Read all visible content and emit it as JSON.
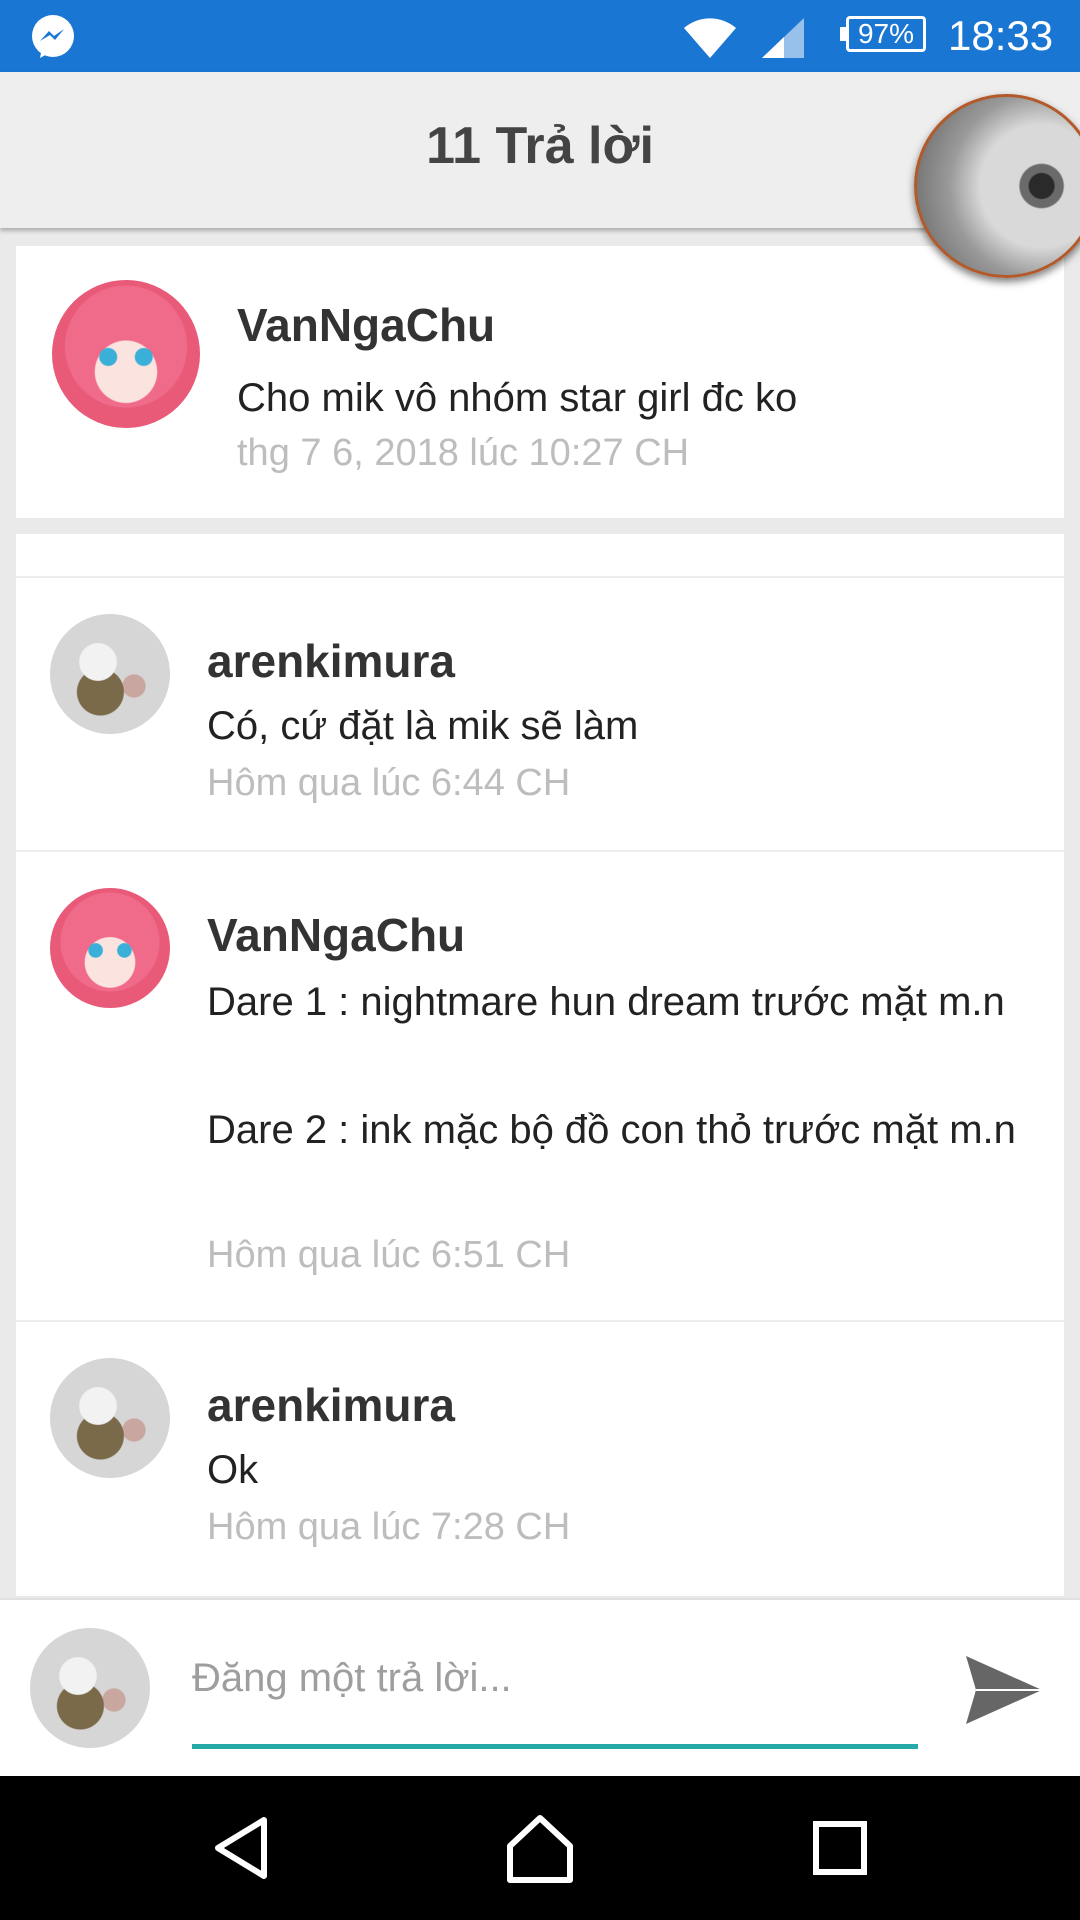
{
  "status_bar": {
    "battery": "97%",
    "time": "18:33",
    "icons": [
      "messenger-icon",
      "wifi-icon",
      "cell-signal-icon",
      "battery-icon"
    ]
  },
  "header": {
    "title": "11 Trả lời"
  },
  "post": {
    "author": "VanNgaChu",
    "text": "Cho mik vô nhóm star girl đc ko",
    "time": "thg 7 6, 2018 lúc 10:27 CH"
  },
  "replies": [
    {
      "author": "arenkimura",
      "lines": [
        "Có, cứ đặt là mik sẽ làm"
      ],
      "time": "Hôm qua lúc 6:44 CH"
    },
    {
      "author": "VanNgaChu",
      "lines": [
        "Dare 1 : nightmare hun dream trước  mặt m.n",
        "Dare 2 : ink mặc bộ đồ con thỏ trước mặt m.n"
      ],
      "time": "Hôm qua lúc 6:51 CH"
    },
    {
      "author": "arenkimura",
      "lines": [
        "Ok"
      ],
      "time": "Hôm qua lúc 7:28 CH"
    }
  ],
  "composer": {
    "placeholder": "Đăng một trả lời...",
    "accent_color": "#25a9a9"
  },
  "navigation": {
    "buttons": [
      "back-icon",
      "home-icon",
      "recents-icon"
    ]
  },
  "colors": {
    "status_bar": "#1976d2",
    "timestamp": "#bdbdbd"
  }
}
